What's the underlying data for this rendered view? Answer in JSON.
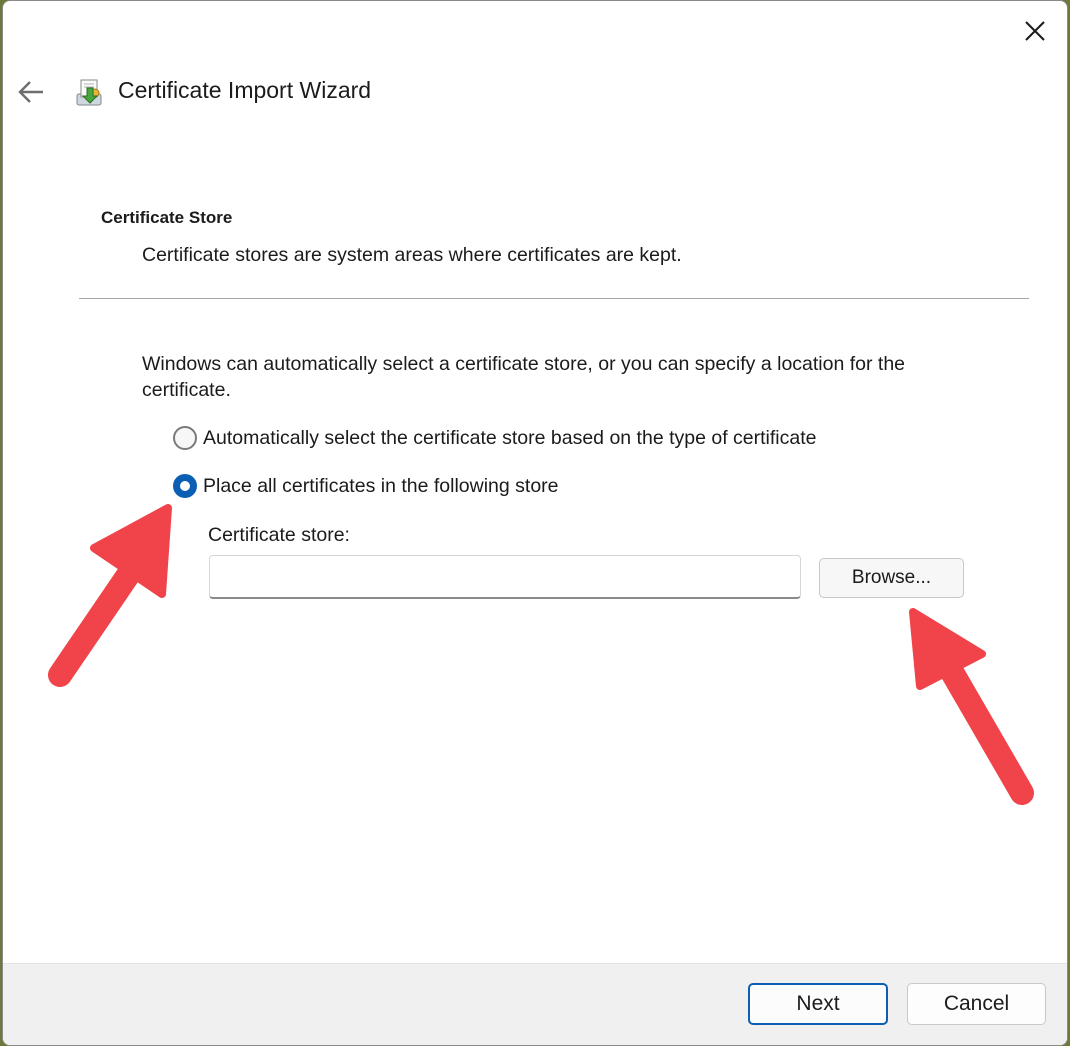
{
  "window": {
    "title": "Certificate Import Wizard"
  },
  "page": {
    "section_title": "Certificate Store",
    "section_description": "Certificate stores are system areas where certificates are kept.",
    "intro": "Windows can automatically select a certificate store, or you can specify a location for the certificate.",
    "options": [
      {
        "label": "Automatically select the certificate store based on the type of certificate",
        "selected": false
      },
      {
        "label": "Place all certificates in the following store",
        "selected": true
      }
    ],
    "store_label": "Certificate store:",
    "store_value": "",
    "browse_label": "Browse..."
  },
  "footer": {
    "next_label": "Next",
    "cancel_label": "Cancel"
  },
  "annotations": {
    "arrow_color": "#f0434a",
    "accent_color": "#0a5fb4"
  },
  "icons": [
    "close-icon",
    "back-arrow-icon",
    "certificate-wizard-icon"
  ]
}
